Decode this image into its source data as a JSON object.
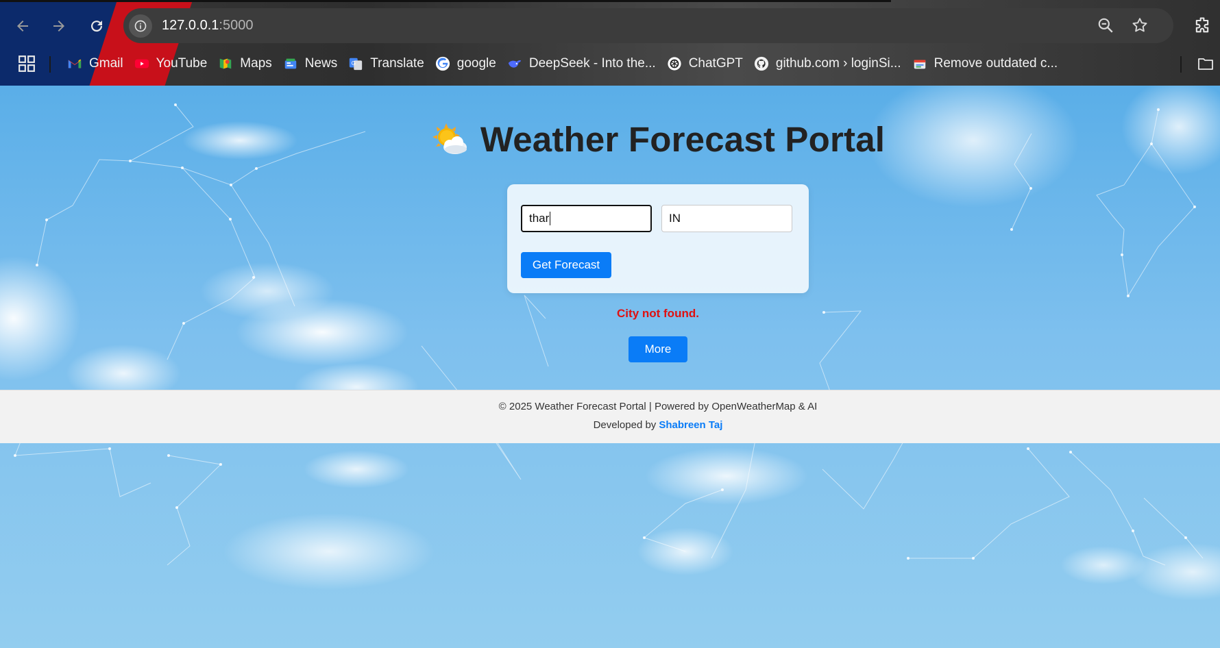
{
  "browser": {
    "url_host": "127.0.0.1",
    "url_port": ":5000",
    "bookmarks": [
      {
        "label": "Gmail",
        "icon": "gmail-icon"
      },
      {
        "label": "YouTube",
        "icon": "youtube-icon"
      },
      {
        "label": "Maps",
        "icon": "maps-icon"
      },
      {
        "label": "News",
        "icon": "news-icon"
      },
      {
        "label": "Translate",
        "icon": "translate-icon"
      },
      {
        "label": "google",
        "icon": "google-icon"
      },
      {
        "label": "DeepSeek - Into the...",
        "icon": "deepseek-icon"
      },
      {
        "label": "ChatGPT",
        "icon": "chatgpt-icon"
      },
      {
        "label": "github.com › loginSi...",
        "icon": "github-icon"
      },
      {
        "label": "Remove outdated c...",
        "icon": "remove-content-icon"
      }
    ]
  },
  "page": {
    "title": "Weather Forecast Portal",
    "title_icon": "sun-behind-cloud-icon",
    "form": {
      "city_value": "thar",
      "country_value": "IN",
      "submit_label": "Get Forecast"
    },
    "error_message": "City not found.",
    "more_label": "More",
    "footer": {
      "copyright": "© 2025 Weather Forecast Portal | Powered by OpenWeatherMap & AI",
      "developed_by": "Developed by",
      "developer_name": "Shabreen Taj"
    }
  },
  "colors": {
    "accent": "#0a7cf7",
    "error": "#e01010",
    "title": "#222222",
    "footer_bg": "#f2f2f2"
  }
}
